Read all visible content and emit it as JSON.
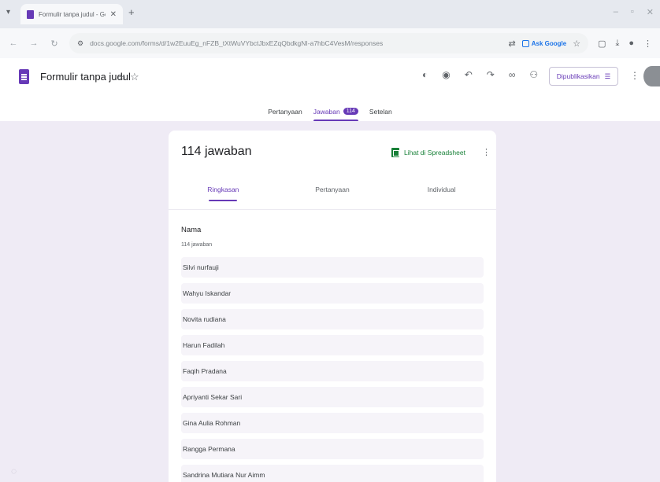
{
  "browser": {
    "tab_title": "Formulir tanpa judul - Google",
    "url": "docs.google.com/forms/d/1w2EuuEg_nFZB_tXtWuVYbctJbxEZqQbdkgNI-a7hbC4VesM/responses",
    "ask_google_label": "Ask Google"
  },
  "header": {
    "form_title": "Formulir tanpa judul",
    "publish_label": "Dipublikasikan",
    "tabs": [
      {
        "label": "Pertanyaan"
      },
      {
        "label": "Jawaban",
        "badge": "114"
      },
      {
        "label": "Setelan"
      }
    ]
  },
  "summary": {
    "title": "114 jawaban",
    "sheets_link": "Lihat di Spreadsheet",
    "subtabs": [
      {
        "label": "Ringkasan"
      },
      {
        "label": "Pertanyaan"
      },
      {
        "label": "Individual"
      }
    ]
  },
  "question": {
    "title": "Nama",
    "count": "114 jawaban",
    "answers": [
      "Silvi nurfauji",
      "Wahyu Iskandar",
      "Novita rudiana",
      "Harun Fadilah",
      "Faqih Pradana",
      "Apriyanti Sekar Sari",
      "Gina Aulia Rohman",
      "Rangga Permana",
      "Sandrina Mutiara Nur Aimm"
    ]
  },
  "colors": {
    "accent": "#673ab7",
    "background": "#efebf5",
    "sheets_green": "#188038"
  }
}
